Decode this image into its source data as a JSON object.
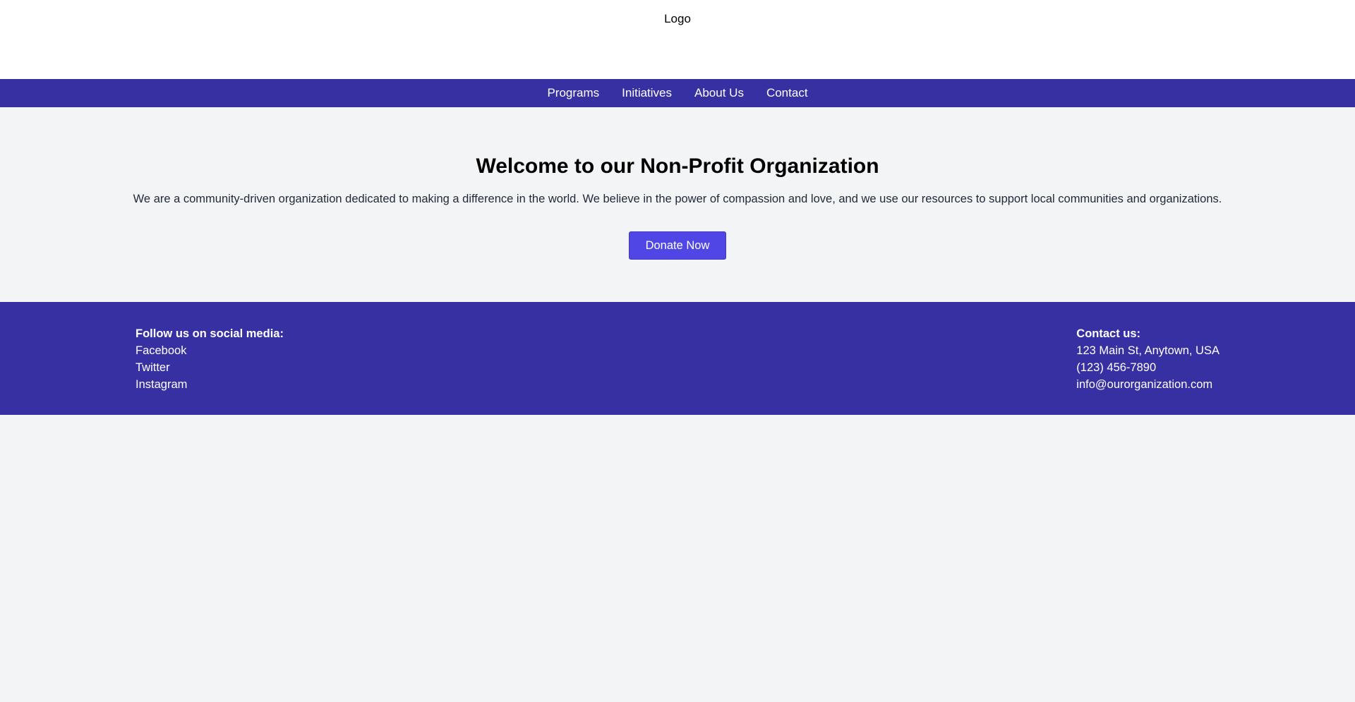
{
  "header": {
    "logo_text": "Logo"
  },
  "nav": {
    "items": [
      {
        "label": "Programs"
      },
      {
        "label": "Initiatives"
      },
      {
        "label": "About Us"
      },
      {
        "label": "Contact"
      }
    ]
  },
  "hero": {
    "title": "Welcome to our Non-Profit Organization",
    "description": "We are a community-driven organization dedicated to making a difference in the world. We believe in the power of compassion and love, and we use our resources to support local communities and organizations.",
    "donate_label": "Donate Now"
  },
  "footer": {
    "social": {
      "heading": "Follow us on social media:",
      "links": [
        {
          "label": "Facebook"
        },
        {
          "label": "Twitter"
        },
        {
          "label": "Instagram"
        }
      ]
    },
    "contact": {
      "heading": "Contact us:",
      "address": "123 Main St, Anytown, USA",
      "phone": "(123) 456-7890",
      "email": "info@ourorganization.com"
    }
  },
  "colors": {
    "brand": "#3730a3",
    "button": "#4f46e5",
    "background": "#f3f4f6"
  }
}
